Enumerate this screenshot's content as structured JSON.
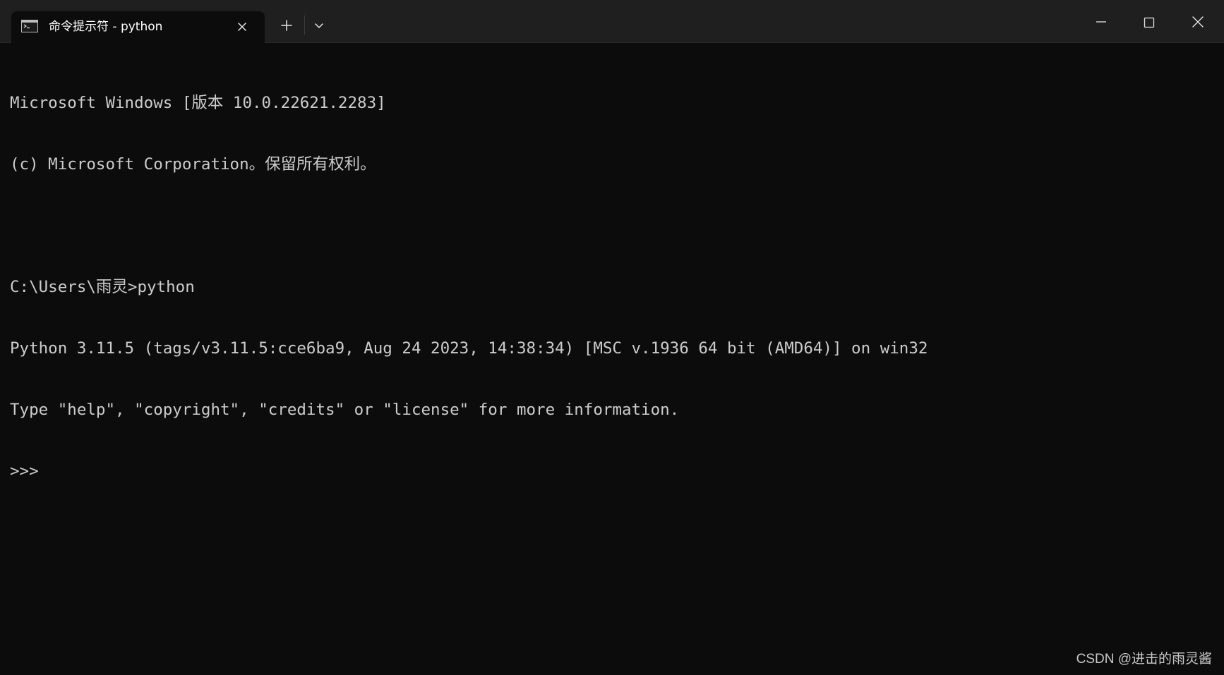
{
  "window": {
    "tab": {
      "icon": "command-prompt-icon",
      "title": "命令提示符 - python",
      "close_icon": "close-icon"
    },
    "new_tab_icon": "plus-icon",
    "dropdown_icon": "chevron-down-icon",
    "controls": {
      "minimize_icon": "minimize-icon",
      "maximize_icon": "maximize-icon",
      "close_icon": "close-icon"
    }
  },
  "terminal": {
    "lines": [
      "Microsoft Windows [版本 10.0.22621.2283]",
      "(c) Microsoft Corporation。保留所有权利。",
      "",
      "C:\\Users\\雨灵>python",
      "Python 3.11.5 (tags/v3.11.5:cce6ba9, Aug 24 2023, 14:38:34) [MSC v.1936 64 bit (AMD64)] on win32",
      "Type \"help\", \"copyright\", \"credits\" or \"license\" for more information.",
      ">>> "
    ]
  },
  "watermark": "CSDN @进击的雨灵酱",
  "colors": {
    "titlebar_bg": "#1f1f1f",
    "terminal_bg": "#0c0c0c",
    "terminal_fg": "#cccccc"
  }
}
